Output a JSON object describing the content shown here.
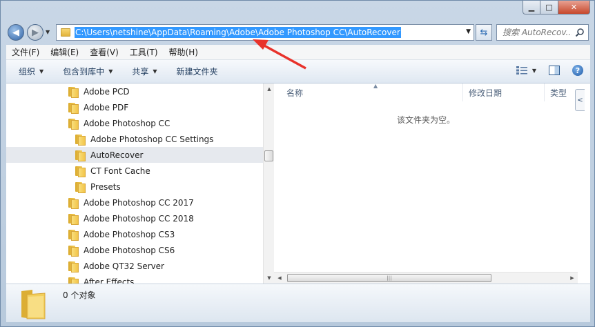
{
  "window": {
    "caption_min": "▁",
    "caption_max": "□",
    "caption_close": "✕"
  },
  "nav": {
    "back_glyph": "◀",
    "forward_glyph": "▶",
    "dropdown_glyph": "▼"
  },
  "address": {
    "path": "C:\\Users\\netshine\\AppData\\Roaming\\Adobe\\Adobe Photoshop CC\\AutoRecover",
    "dropdown_glyph": "▼",
    "refresh_glyph": "⇆"
  },
  "search": {
    "placeholder": "搜索 AutoRecov..."
  },
  "menubar": {
    "items": [
      "文件(F)",
      "编辑(E)",
      "查看(V)",
      "工具(T)",
      "帮助(H)"
    ]
  },
  "commandbar": {
    "organize": "组织",
    "include_in_library": "包含到库中",
    "share": "共享",
    "new_folder": "新建文件夹",
    "caret": "▼",
    "help_glyph": "?"
  },
  "tree": {
    "items": [
      {
        "label": "Adobe PCD",
        "level": 0,
        "selected": false
      },
      {
        "label": "Adobe PDF",
        "level": 0,
        "selected": false
      },
      {
        "label": "Adobe Photoshop CC",
        "level": 0,
        "selected": false
      },
      {
        "label": "Adobe Photoshop CC Settings",
        "level": 1,
        "selected": false
      },
      {
        "label": "AutoRecover",
        "level": 1,
        "selected": true
      },
      {
        "label": "CT Font Cache",
        "level": 1,
        "selected": false
      },
      {
        "label": "Presets",
        "level": 1,
        "selected": false
      },
      {
        "label": "Adobe Photoshop CC 2017",
        "level": 0,
        "selected": false
      },
      {
        "label": "Adobe Photoshop CC 2018",
        "level": 0,
        "selected": false
      },
      {
        "label": "Adobe Photoshop CS3",
        "level": 0,
        "selected": false
      },
      {
        "label": "Adobe Photoshop CS6",
        "level": 0,
        "selected": false
      },
      {
        "label": "Adobe QT32 Server",
        "level": 0,
        "selected": false
      },
      {
        "label": "After Effects",
        "level": 0,
        "selected": false
      }
    ]
  },
  "files": {
    "columns": [
      "名称",
      "修改日期",
      "类型"
    ],
    "empty_message": "该文件夹为空。",
    "sort_glyph": "▲"
  },
  "scroll": {
    "up": "▲",
    "down": "▼",
    "left": "◀",
    "right": "▶",
    "grip": "|||"
  },
  "side_toggle_glyph": "<",
  "details": {
    "status": "0 个对象"
  }
}
